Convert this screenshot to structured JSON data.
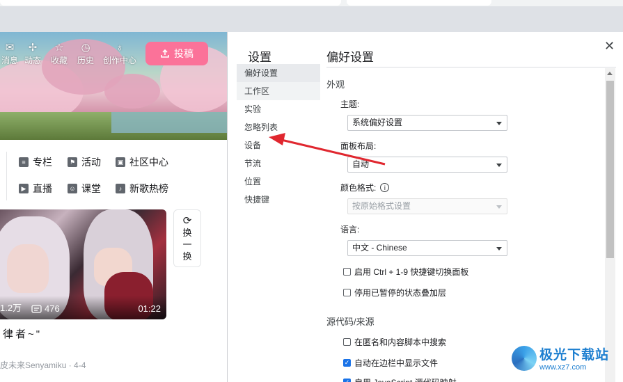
{
  "page": {
    "nav": [
      {
        "label": "消息",
        "icon": "mail-icon",
        "glyph": "✉"
      },
      {
        "label": "动态",
        "icon": "pinwheel-icon",
        "glyph": "✢"
      },
      {
        "label": "收藏",
        "icon": "star-icon",
        "glyph": "☆"
      },
      {
        "label": "历史",
        "icon": "clock-icon",
        "glyph": "◷"
      },
      {
        "label": "创作中心",
        "icon": "bulb-icon",
        "glyph": "♁"
      }
    ],
    "upload_label": "投稿",
    "categories": [
      {
        "label": "专栏",
        "icon": "column-icon"
      },
      {
        "label": "活动",
        "icon": "flag-icon"
      },
      {
        "label": "社区中心",
        "icon": "community-icon"
      },
      {
        "label": "直播",
        "icon": "live-icon"
      },
      {
        "label": "课堂",
        "icon": "class-icon"
      },
      {
        "label": "新歌热榜",
        "icon": "music-icon"
      }
    ],
    "video": {
      "views": "1.2万",
      "danmaku": "476",
      "duration": "01:22",
      "title": "律者~\"",
      "author": "皮未来Senyamiku · 4-4"
    },
    "refresh_label": [
      "换",
      "一",
      "换"
    ]
  },
  "devtools": {
    "settings_title": "设置",
    "nav": [
      "偏好设置",
      "工作区",
      "实验",
      "忽略列表",
      "设备",
      "节流",
      "位置",
      "快捷键"
    ],
    "selected_nav": "偏好设置",
    "content_title": "偏好设置",
    "appearance": {
      "heading": "外观",
      "theme_label": "主题:",
      "theme_value": "系统偏好设置",
      "panel_label": "面板布局:",
      "panel_value": "自动",
      "color_label": "颜色格式:",
      "color_value": "按原始格式设置",
      "lang_label": "语言:",
      "lang_value": "中文 - Chinese",
      "check1": "启用 Ctrl + 1-9 快捷键切换面板",
      "check2": "停用已暂停的状态叠加层"
    },
    "sources": {
      "heading": "源代码/来源",
      "check1": "在匿名和内容脚本中搜索",
      "check2": "自动在边栏中显示文件",
      "check3": "启用 JavaScript 源代码映射"
    }
  },
  "watermark": {
    "main": "极光下载站",
    "sub": "www.xz7.com"
  },
  "colors": {
    "brand_pink": "#fb7299",
    "check_blue": "#1a73e8",
    "arrow_red": "#e0272f"
  }
}
